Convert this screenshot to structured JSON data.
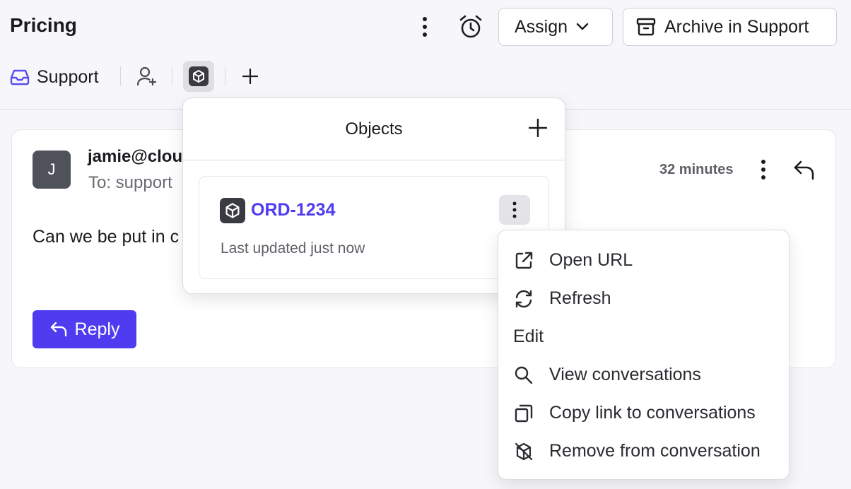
{
  "header": {
    "title": "Pricing",
    "assign_label": "Assign",
    "archive_label": "Archive in Support"
  },
  "tabs": {
    "support_label": "Support"
  },
  "message": {
    "avatar_initial": "J",
    "sender": "jamie@clou",
    "recipient": "To: support",
    "time": "32 minutes",
    "body": "Can we be put in c",
    "reply_label": "Reply"
  },
  "objects_popover": {
    "title": "Objects",
    "item": {
      "id": "ORD-1234",
      "updated": "Last updated just now"
    }
  },
  "context_menu": {
    "items": [
      {
        "label": "Open URL",
        "icon": "external-link-icon"
      },
      {
        "label": "Refresh",
        "icon": "refresh-icon"
      },
      {
        "label": "Edit",
        "icon": ""
      },
      {
        "label": "View conversations",
        "icon": "search-icon"
      },
      {
        "label": "Copy link to conversations",
        "icon": "copy-icon"
      },
      {
        "label": "Remove from conversation",
        "icon": "remove-object-icon"
      }
    ]
  },
  "colors": {
    "accent": "#4f3cf0",
    "support_icon": "#5b4ef0",
    "background": "#f7f7fb"
  }
}
